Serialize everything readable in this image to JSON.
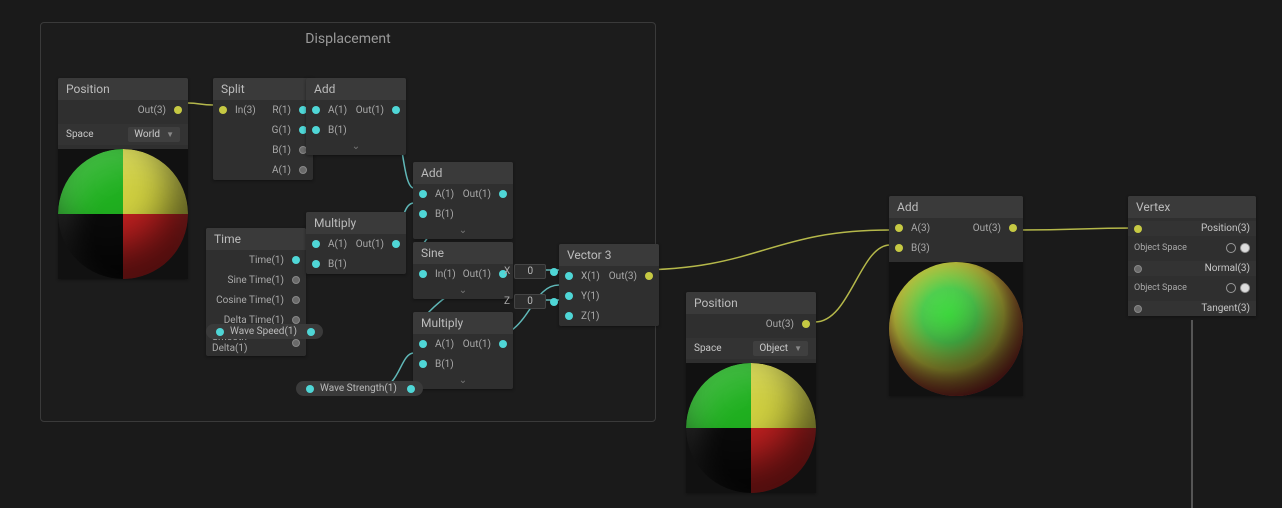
{
  "group": {
    "title": "Displacement"
  },
  "nodes": {
    "position1": {
      "title": "Position",
      "out": "Out(3)",
      "space_label": "Space",
      "space_value": "World"
    },
    "split": {
      "title": "Split",
      "in": "In(3)",
      "r": "R(1)",
      "g": "G(1)",
      "b": "B(1)",
      "a": "A(1)"
    },
    "time": {
      "title": "Time",
      "time": "Time(1)",
      "sine": "Sine Time(1)",
      "cosine": "Cosine Time(1)",
      "delta": "Delta Time(1)",
      "smooth": "Smooth Delta(1)"
    },
    "add1": {
      "title": "Add",
      "a": "A(1)",
      "b": "B(1)",
      "out": "Out(1)"
    },
    "multiply1": {
      "title": "Multiply",
      "a": "A(1)",
      "b": "B(1)",
      "out": "Out(1)"
    },
    "add2": {
      "title": "Add",
      "a": "A(1)",
      "b": "B(1)",
      "out": "Out(1)"
    },
    "sine": {
      "title": "Sine",
      "in": "In(1)",
      "out": "Out(1)"
    },
    "multiply2": {
      "title": "Multiply",
      "a": "A(1)",
      "b": "B(1)",
      "out": "Out(1)"
    },
    "vector3": {
      "title": "Vector 3",
      "x": "X(1)",
      "y": "Y(1)",
      "z": "Z(1)",
      "out": "Out(3)",
      "x_label": "X",
      "x_val": "0",
      "z_label": "Z",
      "z_val": "0"
    },
    "position2": {
      "title": "Position",
      "out": "Out(3)",
      "space_label": "Space",
      "space_value": "Object"
    },
    "add3": {
      "title": "Add",
      "a": "A(3)",
      "b": "B(3)",
      "out": "Out(3)"
    },
    "vertex": {
      "title": "Vertex",
      "position": "Position(3)",
      "normal": "Normal(3)",
      "tangent": "Tangent(3)",
      "space1": "Object Space",
      "space2": "Object Space"
    }
  },
  "pills": {
    "wave_speed": "Wave Speed(1)",
    "wave_strength": "Wave Strength(1)"
  },
  "colors": {
    "wire_yellow": "#b5b84a",
    "wire_cyan": "#5fb8b8"
  }
}
